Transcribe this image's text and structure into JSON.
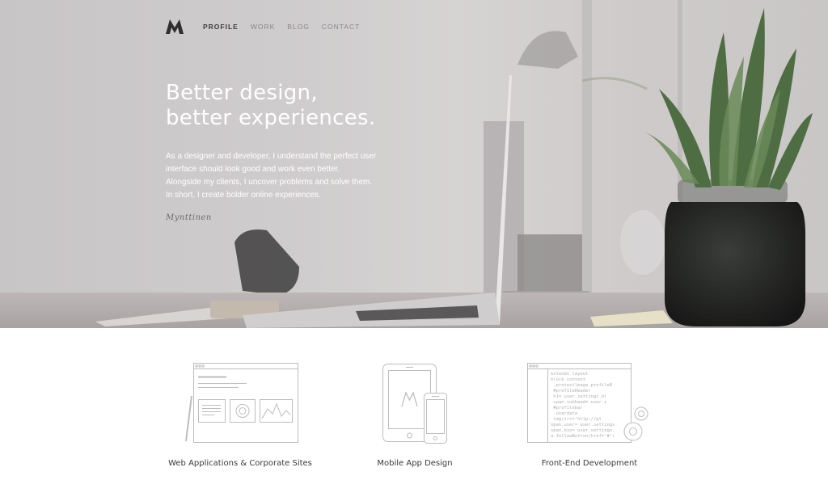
{
  "nav": {
    "logo": "M-logo",
    "items": [
      {
        "label": "PROFILE",
        "active": true
      },
      {
        "label": "WORK",
        "active": false
      },
      {
        "label": "BLOG",
        "active": false
      },
      {
        "label": "CONTACT",
        "active": false
      }
    ]
  },
  "hero": {
    "headline": [
      "Better design,",
      "better experiences."
    ],
    "intro": [
      "As a designer and developer, I understand the perfect user",
      "interface should look good and work even better.",
      "Alongside my clients, I uncover problems and solve them.",
      "In short, I create bolder online experiences."
    ],
    "signature": "Mynttinen"
  },
  "services": [
    {
      "label": "Web Applications & Corporate Sites",
      "icon": "browser-wireframe-icon"
    },
    {
      "label": "Mobile App Design",
      "icon": "tablet-phone-icon"
    },
    {
      "label": "Front-End Development",
      "icon": "code-editor-icon"
    }
  ],
  "code_snippet": [
    "extends layout",
    "block content",
    "  .protectlmage.profileRetrain",
    "  #profileHeader",
    "    h1= user.settings.blog.t",
    "    span.subhead= user.setti",
    "  #profilebar",
    "    .userdata",
    "      img(src='http://placeh",
    "span.user= user.settings.n",
    "span.bio= user.settings.b",
    "a.followButton(href='#')"
  ],
  "colors": {
    "hero_bg": "#cfcccd",
    "nav_active": "#3f3c3e",
    "nav_inactive": "#8b8789",
    "icon_stroke": "#bdbdbd"
  }
}
